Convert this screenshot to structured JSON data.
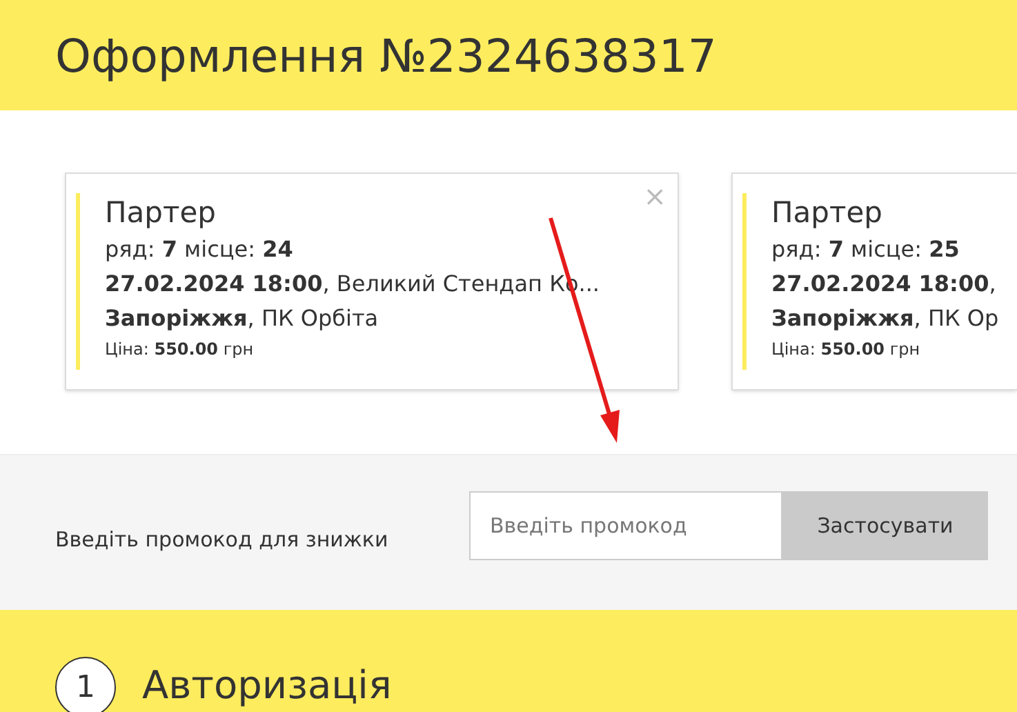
{
  "header": {
    "title": "Оформлення №2324638317"
  },
  "tickets": [
    {
      "section": "Партер",
      "seat": "ряд: **7** місце: **24**",
      "event": "**27.02.2024 18:00**, Великий Стендап Ко...",
      "venue": "**Запоріжжя**, ПК Орбіта",
      "price": "Ціна: **550.00** грн",
      "close": "×"
    },
    {
      "section": "Партер",
      "seat": "ряд: **7** місце: **25**",
      "event": "**27.02.2024 18:00**,",
      "venue": "**Запоріжжя**, ПК Ор",
      "price": "Ціна: **550.00** грн"
    }
  ],
  "promo": {
    "label": "Введіть промокод для знижки",
    "placeholder": "Введіть промокод",
    "button": "Застосувати"
  },
  "step": {
    "number": "1",
    "title": "Авторизація"
  }
}
